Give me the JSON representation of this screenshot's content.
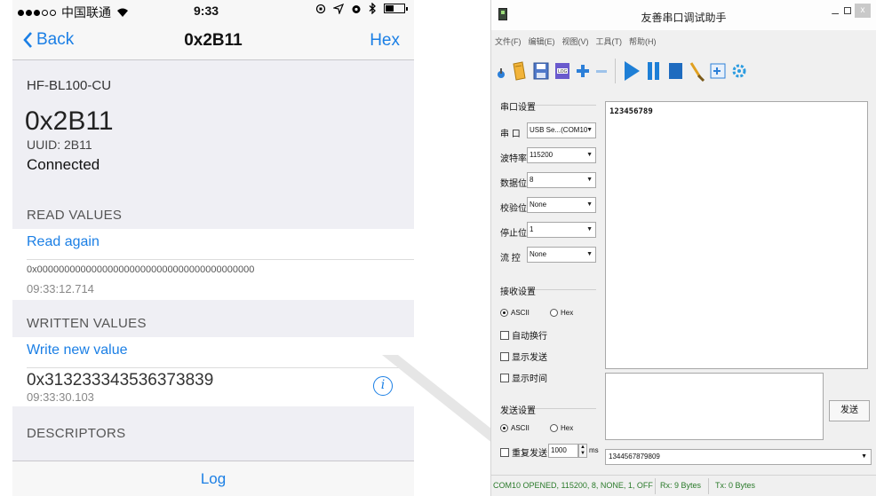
{
  "phone": {
    "status": {
      "carrier": "中国联通",
      "time": "9:33"
    },
    "nav": {
      "back_label": "Back",
      "title": "0x2B11",
      "hex_label": "Hex"
    },
    "device_name": "HF-BL100-CU",
    "characteristic": {
      "name": "0x2B11",
      "uuid": "UUID: 2B11",
      "status": "Connected"
    },
    "read_section": {
      "header": "READ VALUES",
      "action": "Read again",
      "value": "0x0000000000000000000000000000000000000000",
      "timestamp": "09:33:12.714"
    },
    "written_section": {
      "header": "WRITTEN VALUES",
      "action": "Write new value",
      "value": "0x313233343536373839",
      "timestamp": "09:33:30.103",
      "info_icon": "i"
    },
    "descriptors_header": "DESCRIPTORS",
    "tab_label": "Log",
    "accent_color": "#1b7fe5"
  },
  "app": {
    "title": "友善串口调试助手",
    "menu": [
      "文件(F)",
      "编辑(E)",
      "视图(V)",
      "工具(T)",
      "帮助(H)"
    ],
    "serial_settings": {
      "group": "串口设置",
      "fields": [
        {
          "label": "串 口",
          "value": "USB Se...(COM10"
        },
        {
          "label": "波特率",
          "value": "115200"
        },
        {
          "label": "数据位",
          "value": "8"
        },
        {
          "label": "校验位",
          "value": "None"
        },
        {
          "label": "停止位",
          "value": "1"
        },
        {
          "label": "流 控",
          "value": "None"
        }
      ]
    },
    "receive_settings": {
      "group": "接收设置",
      "ascii": "ASCII",
      "hex": "Hex",
      "auto_wrap": "自动换行",
      "show_send": "显示发送",
      "show_time": "显示时间"
    },
    "send_settings": {
      "group": "发送设置",
      "ascii": "ASCII",
      "hex": "Hex",
      "repeat_send": "重复发送",
      "interval": "1000",
      "unit": "ms"
    },
    "receive_text": "123456789",
    "send_button": "发送",
    "history_value": "1344567879809",
    "status": {
      "port": "COM10 OPENED, 115200, 8, NONE, 1, OFF",
      "rx": "Rx: 9 Bytes",
      "tx": "Tx: 0 Bytes"
    },
    "close_label": "x"
  }
}
